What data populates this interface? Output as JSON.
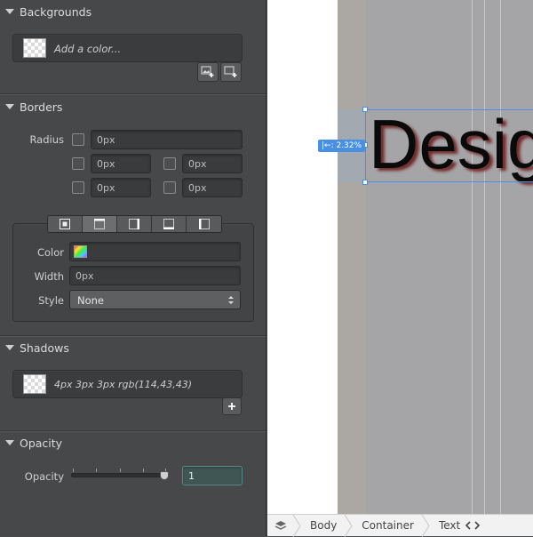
{
  "backgrounds": {
    "title": "Backgrounds",
    "placeholder": "Add a color..."
  },
  "borders": {
    "title": "Borders",
    "radius_label": "Radius",
    "radius_all": "0px",
    "radius_tl": "0px",
    "radius_tr": "0px",
    "radius_bl": "0px",
    "radius_br": "0px",
    "color_label": "Color",
    "width_label": "Width",
    "width_value": "0px",
    "style_label": "Style",
    "style_value": "None"
  },
  "shadows": {
    "title": "Shadows",
    "value": "4px 3px 3px rgb(114,43,43)"
  },
  "opacity": {
    "title": "Opacity",
    "label": "Opacity",
    "value": "1",
    "level": 1.0
  },
  "canvas": {
    "heading_text": "Design",
    "margin_badge": "|←: 2.32%"
  },
  "breadcrumb": {
    "items": [
      "Body",
      "Container",
      "Text"
    ]
  },
  "colors": {
    "panel_bg": "#47484a",
    "accent": "#4a90e2",
    "shadow_color": "#722b2b"
  }
}
